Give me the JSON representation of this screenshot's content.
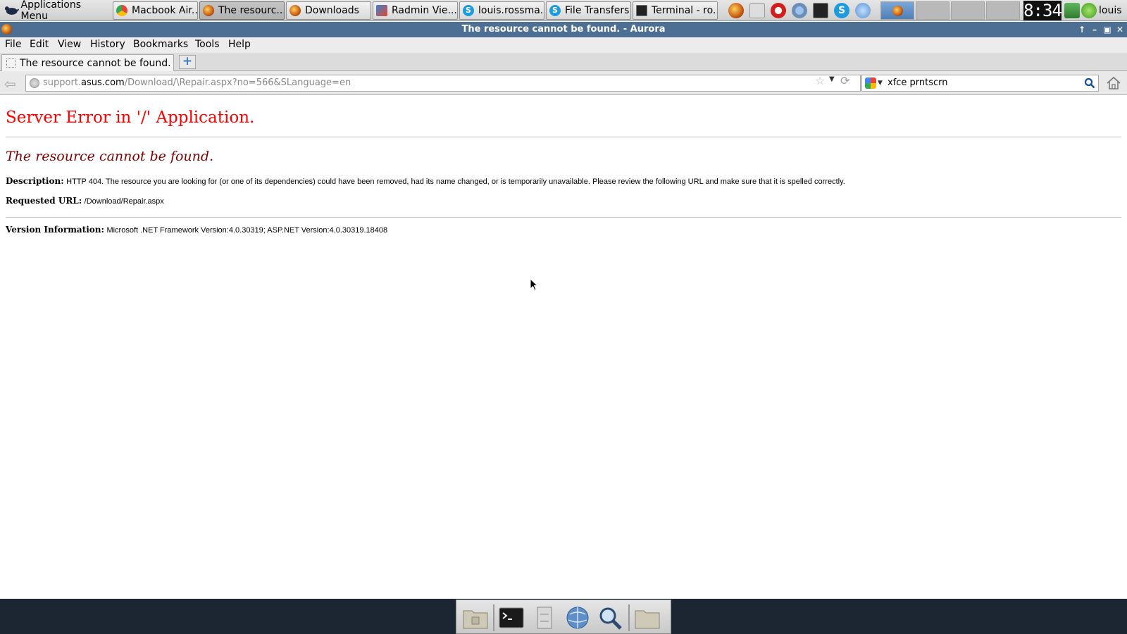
{
  "panel": {
    "apps_menu_label": "Applications Menu",
    "tasks": [
      {
        "label": "Macbook Air...",
        "icon": "chrome-icon"
      },
      {
        "label": "The resourc...",
        "icon": "aurora-icon"
      },
      {
        "label": "Downloads",
        "icon": "aurora-icon"
      },
      {
        "label": "Radmin Vie...",
        "icon": "radmin-icon"
      },
      {
        "label": "louis.rossma...",
        "icon": "skype-icon"
      },
      {
        "label": "File Transfers",
        "icon": "skype-icon"
      },
      {
        "label": "Terminal - ro...",
        "icon": "terminal-icon"
      }
    ],
    "clock": "8:34",
    "user": "louis"
  },
  "window": {
    "title": "The resource cannot be found. - Aurora"
  },
  "menubar": {
    "items": [
      "File",
      "Edit",
      "View",
      "History",
      "Bookmarks",
      "Tools",
      "Help"
    ]
  },
  "tabs": [
    {
      "label": "The resource cannot be found."
    }
  ],
  "navbar": {
    "url_prefix": "support.",
    "url_host": "asus.com",
    "url_path": "/Download/\\Repair.aspx?no=566&SLanguage=en",
    "search_value": "xfce prntscrn"
  },
  "page": {
    "heading": "Server Error in '/' Application.",
    "subheading": "The resource cannot be found.",
    "description_label": "Description:",
    "description_text": "HTTP 404. The resource you are looking for (or one of its dependencies) could have been removed, had its name changed, or is temporarily unavailable.  Please review the following URL and make sure that it is spelled correctly.",
    "requested_url_label": "Requested URL:",
    "requested_url_value": "/Download/Repair.aspx",
    "version_label": "Version Information:",
    "version_text": "Microsoft .NET Framework Version:4.0.30319; ASP.NET Version:4.0.30319.18408"
  },
  "colors": {
    "heading": "#ff0000",
    "subheading": "#800000",
    "titlebar": "#4d6f93",
    "dock_bg": "#1c2633"
  }
}
